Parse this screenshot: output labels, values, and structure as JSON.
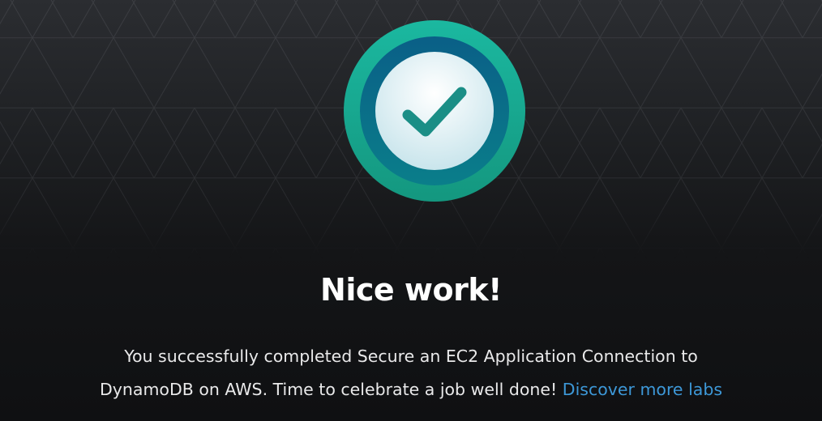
{
  "completion": {
    "badge_icon": "checkmark-icon",
    "title": "Nice work!",
    "message_text": "You successfully completed Secure an EC2 Application Connection to DynamoDB on AWS. Time to celebrate a job well done! ",
    "link_label": "Discover more labs"
  },
  "colors": {
    "badge_outer": "#1aa58f",
    "badge_ring": "#0a6d89",
    "check": "#1b8e86",
    "link": "#3d98d8"
  }
}
